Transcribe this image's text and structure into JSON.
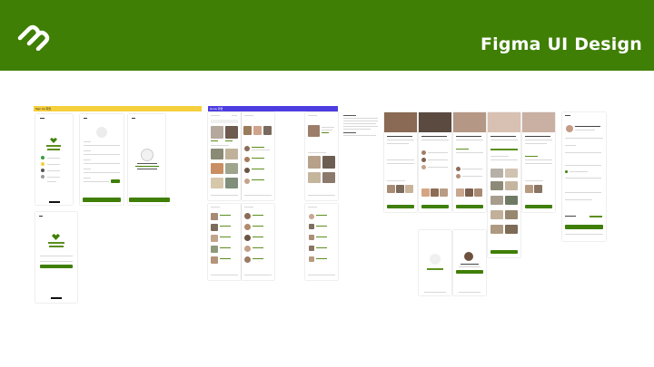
{
  "header": {
    "title": "Figma UI Design",
    "logo_icon": "brand-logo-icon",
    "bar_color": "#3f7f05"
  },
  "sections": [
    {
      "label": "Sign Up 화면",
      "color": "#f5cf3c"
    },
    {
      "label": "Home 화면",
      "color": "#4d3de0"
    }
  ],
  "colors": {
    "accent": "#3f7f05",
    "bar_yellow": "#f5cf3c",
    "bar_blue": "#4d3de0"
  }
}
